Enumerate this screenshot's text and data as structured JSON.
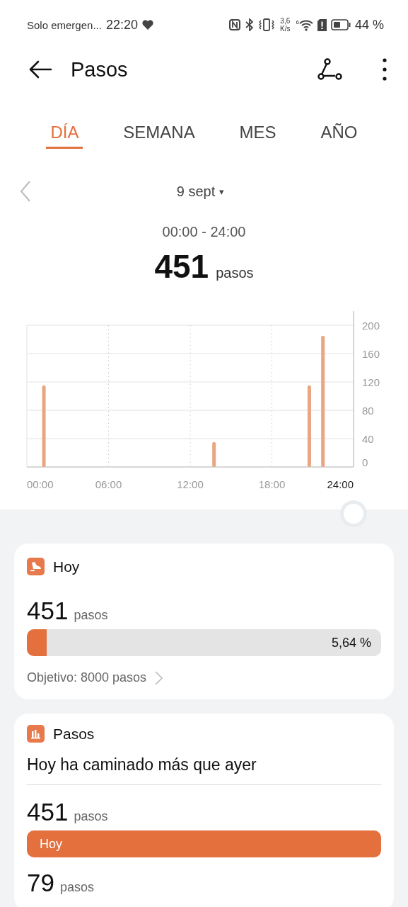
{
  "status_bar": {
    "carrier": "Solo emergen...",
    "time": "22:20",
    "speed_value": "3,6",
    "speed_unit": "K/s",
    "wifi_badge": "6",
    "battery_text": "44 %"
  },
  "header": {
    "title": "Pasos"
  },
  "tabs": [
    {
      "label": "DÍA",
      "selected": true
    },
    {
      "label": "SEMANA",
      "selected": false
    },
    {
      "label": "MES",
      "selected": false
    },
    {
      "label": "AÑO",
      "selected": false
    }
  ],
  "date": {
    "label": "9 sept",
    "caret": "▾"
  },
  "range": "00:00 - 24:00",
  "total": {
    "value": "451",
    "unit": "pasos"
  },
  "chart": {
    "chart_data": {
      "type": "bar",
      "x": [
        1.25,
        13.75,
        20.75,
        21.75
      ],
      "values": [
        115,
        35,
        115,
        185
      ],
      "xlim": [
        0,
        24
      ],
      "ylim": [
        0,
        200
      ],
      "xticks": [
        {
          "value": 0,
          "label": "00:00"
        },
        {
          "value": 6,
          "label": "06:00"
        },
        {
          "value": 12,
          "label": "12:00"
        },
        {
          "value": 18,
          "label": "18:00"
        },
        {
          "value": 24,
          "label": "24:00"
        }
      ],
      "yticks": [
        0,
        40,
        80,
        120,
        160,
        200
      ],
      "grid": true
    }
  },
  "goal_card": {
    "title": "Hoy",
    "value": "451",
    "unit": "pasos",
    "level": 0.0564,
    "percent": "5,64 %",
    "goal": "Objetivo: 8000 pasos"
  },
  "steps_card": {
    "title": "Pasos",
    "summary": "Hoy ha caminado más que ayer",
    "rows": [
      {
        "value": "451",
        "unit": "pasos",
        "bar_label": "Hoy"
      },
      {
        "value": "79",
        "unit": "pasos"
      }
    ]
  }
}
